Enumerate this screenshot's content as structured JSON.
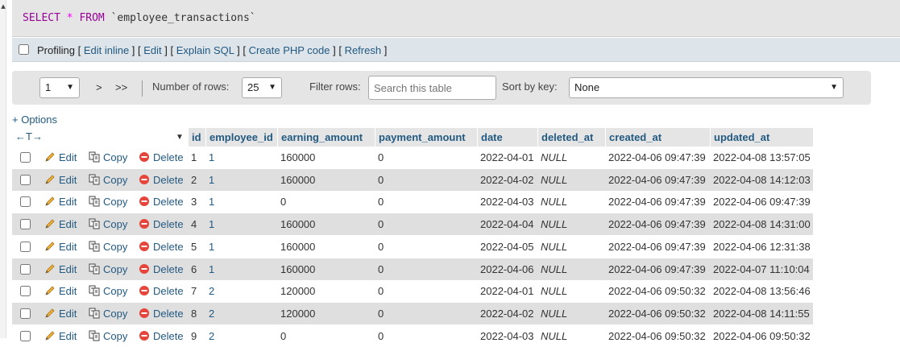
{
  "sql": {
    "select_kw": "SELECT",
    "star": "*",
    "from_kw": "FROM",
    "table": "`employee_transactions`"
  },
  "profiling": {
    "label": "Profiling",
    "links": [
      "Edit inline",
      "Edit",
      "Explain SQL",
      "Create PHP code",
      "Refresh"
    ]
  },
  "nav": {
    "page_value": "1",
    "next_label": ">",
    "last_label": ">>",
    "rows_label": "Number of rows:",
    "rows_value": "25",
    "filter_label": "Filter rows:",
    "filter_placeholder": "Search this table",
    "sort_label": "Sort by key:",
    "sort_value": "None"
  },
  "options_label": "+ Options",
  "table": {
    "arrows": "←T→",
    "columns": [
      "id",
      "employee_id",
      "earning_amount",
      "payment_amount",
      "date",
      "deleted_at",
      "created_at",
      "updated_at"
    ],
    "actions": {
      "edit": "Edit",
      "copy": "Copy",
      "delete": "Delete"
    },
    "rows": [
      {
        "id": "1",
        "employee_id": "1",
        "earning_amount": "160000",
        "payment_amount": "0",
        "date": "2022-04-01",
        "deleted_at": "NULL",
        "created_at": "2022-04-06 09:47:39",
        "updated_at": "2022-04-08 13:57:05"
      },
      {
        "id": "2",
        "employee_id": "1",
        "earning_amount": "160000",
        "payment_amount": "0",
        "date": "2022-04-02",
        "deleted_at": "NULL",
        "created_at": "2022-04-06 09:47:39",
        "updated_at": "2022-04-08 14:12:03"
      },
      {
        "id": "3",
        "employee_id": "1",
        "earning_amount": "0",
        "payment_amount": "0",
        "date": "2022-04-03",
        "deleted_at": "NULL",
        "created_at": "2022-04-06 09:47:39",
        "updated_at": "2022-04-06 09:47:39"
      },
      {
        "id": "4",
        "employee_id": "1",
        "earning_amount": "160000",
        "payment_amount": "0",
        "date": "2022-04-04",
        "deleted_at": "NULL",
        "created_at": "2022-04-06 09:47:39",
        "updated_at": "2022-04-08 14:31:00"
      },
      {
        "id": "5",
        "employee_id": "1",
        "earning_amount": "160000",
        "payment_amount": "0",
        "date": "2022-04-05",
        "deleted_at": "NULL",
        "created_at": "2022-04-06 09:47:39",
        "updated_at": "2022-04-06 12:31:38"
      },
      {
        "id": "6",
        "employee_id": "1",
        "earning_amount": "160000",
        "payment_amount": "0",
        "date": "2022-04-06",
        "deleted_at": "NULL",
        "created_at": "2022-04-06 09:47:39",
        "updated_at": "2022-04-07 11:10:04"
      },
      {
        "id": "7",
        "employee_id": "2",
        "earning_amount": "120000",
        "payment_amount": "0",
        "date": "2022-04-01",
        "deleted_at": "NULL",
        "created_at": "2022-04-06 09:50:32",
        "updated_at": "2022-04-08 13:56:46"
      },
      {
        "id": "8",
        "employee_id": "2",
        "earning_amount": "120000",
        "payment_amount": "0",
        "date": "2022-04-02",
        "deleted_at": "NULL",
        "created_at": "2022-04-06 09:50:32",
        "updated_at": "2022-04-08 14:11:55"
      },
      {
        "id": "9",
        "employee_id": "2",
        "earning_amount": "0",
        "payment_amount": "0",
        "date": "2022-04-03",
        "deleted_at": "NULL",
        "created_at": "2022-04-06 09:50:32",
        "updated_at": "2022-04-06 09:50:32"
      }
    ]
  },
  "colors": {
    "link": "#235a81",
    "sql_keyword": "#990099",
    "sql_operator": "#ff00ff",
    "row_alt": "#dfdfdf",
    "delete_icon": "#e5453a",
    "edit_icon": "#e6a23c"
  },
  "icons": {
    "edit": "pencil-icon",
    "copy": "copy-icon",
    "delete": "delete-circle-icon"
  }
}
